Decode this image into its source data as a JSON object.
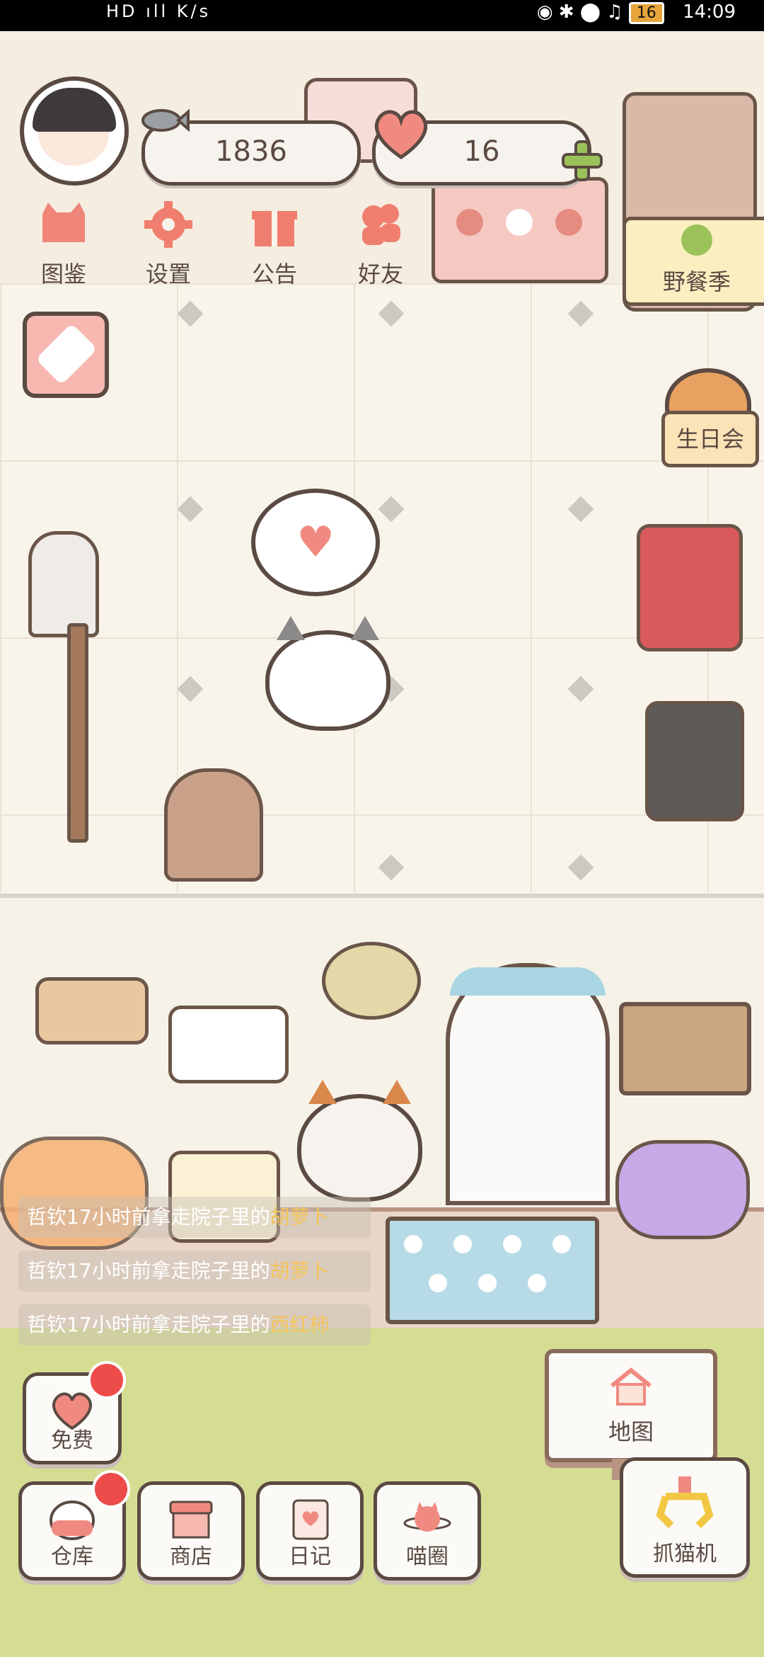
{
  "status_bar": {
    "left_text": "HD ıll K/s",
    "battery": "16",
    "time": "14:09"
  },
  "hud": {
    "fish_count": "1836",
    "heart_count": "16"
  },
  "top_menu": [
    {
      "label": "图鉴",
      "icon": "cat-book-icon",
      "color": "#f0857a"
    },
    {
      "label": "设置",
      "icon": "gear-icon",
      "color": "#f07e6e"
    },
    {
      "label": "公告",
      "icon": "gift-icon",
      "color": "#f07e6e"
    },
    {
      "label": "好友",
      "icon": "friends-icon",
      "color": "#f07e6e"
    }
  ],
  "events": {
    "picnic": "野餐季",
    "birthday": "生日会"
  },
  "chat_log": [
    {
      "prefix": "哲钦17小时前拿走院子里的",
      "item": "胡萝卜"
    },
    {
      "prefix": "哲钦17小时前拿走院子里的",
      "item": "胡萝卜"
    },
    {
      "prefix": "哲钦17小时前拿走院子里的",
      "item": "西红柿"
    }
  ],
  "bottom": {
    "free": "免费",
    "warehouse": "仓库",
    "shop": "商店",
    "diary": "日记",
    "meow_circle": "喵圈",
    "map": "地图",
    "claw_machine": "抓猫机"
  },
  "colors": {
    "accent_pink": "#f08a80",
    "outline": "#5a4a42",
    "notification_red": "#ee4b4b",
    "grass": "#d5dd93"
  }
}
